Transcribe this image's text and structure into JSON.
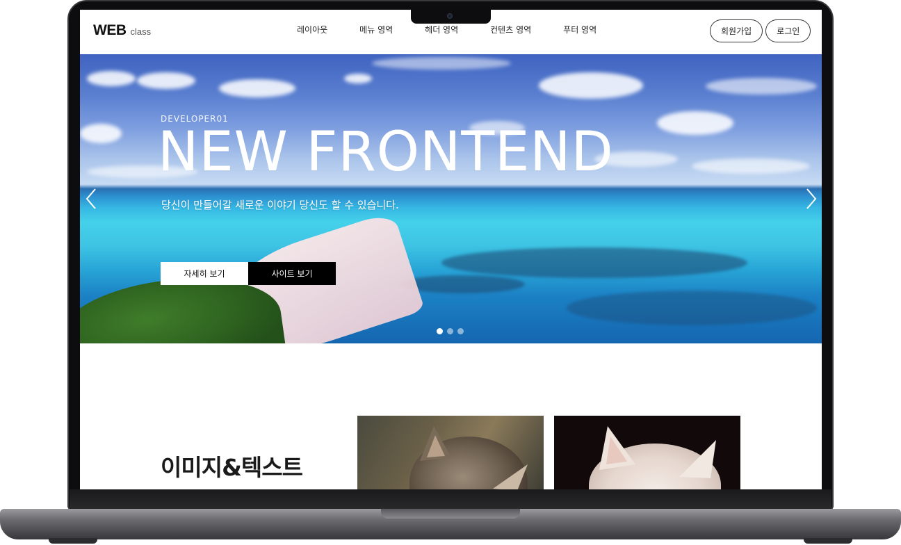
{
  "header": {
    "logo_main": "WEB",
    "logo_sub": "class",
    "nav": [
      "레이아웃",
      "메뉴 영역",
      "헤더 영역",
      "컨텐츠 영역",
      "푸터 영역"
    ],
    "signup_label": "회원가입",
    "login_label": "로그인"
  },
  "hero": {
    "subtitle": "DEVELOPER01",
    "title": "NEW FRONTEND",
    "description": "당신이 만들어갈 새로운 이야기 당신도 할 수 있습니다.",
    "btn_detail": "자세히 보기",
    "btn_site": "사이트 보기",
    "prev_icon": "chevron-left-icon",
    "next_icon": "chevron-right-icon",
    "slide_count": 3,
    "active_slide": 1
  },
  "content": {
    "title": "이미지&텍스트"
  },
  "colors": {
    "accent_dark": "#000000",
    "accent_light": "#ffffff"
  }
}
